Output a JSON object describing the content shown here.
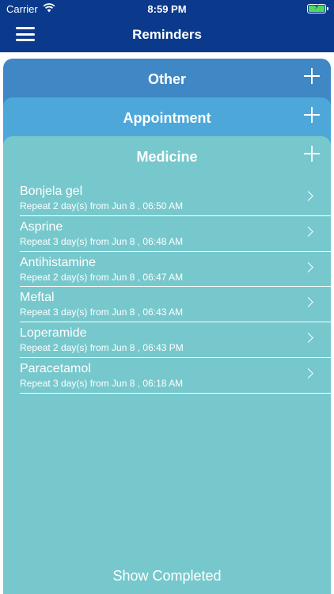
{
  "status_bar": {
    "carrier": "Carrier",
    "time": "8:59 PM"
  },
  "header": {
    "title": "Reminders",
    "menu_icon": "hamburger-menu-icon"
  },
  "sections": {
    "other": {
      "title": "Other"
    },
    "appointment": {
      "title": "Appointment"
    },
    "medicine": {
      "title": "Medicine"
    }
  },
  "medicine_items": [
    {
      "name": "Bonjela gel",
      "schedule": "Repeat 2 day(s) from Jun 8 , 06:50 AM"
    },
    {
      "name": "Asprine",
      "schedule": "Repeat 3 day(s) from Jun 8 , 06:48 AM"
    },
    {
      "name": "Antihistamine",
      "schedule": "Repeat 2 day(s) from Jun 8 , 06:47 AM"
    },
    {
      "name": "Meftal",
      "schedule": "Repeat 3 day(s) from Jun 8 , 06:43 AM"
    },
    {
      "name": "Loperamide",
      "schedule": "Repeat 2 day(s) from Jun 8 , 06:43 PM"
    },
    {
      "name": "Paracetamol",
      "schedule": "Repeat 3 day(s) from Jun 8 , 06:18 AM"
    }
  ],
  "footer": {
    "show_completed_label": "Show Completed"
  },
  "colors": {
    "header": "#0b3a8c",
    "other_section": "#3f88c5",
    "appointment_section": "#4ea7d9",
    "medicine_section": "#77c8cc"
  }
}
